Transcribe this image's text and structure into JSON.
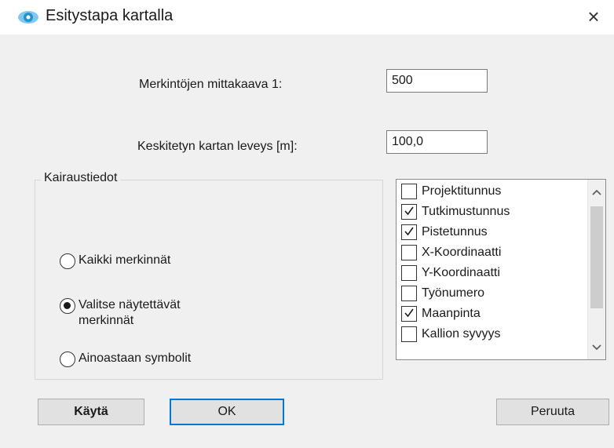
{
  "window": {
    "title": "Esitystapa kartalla",
    "close_glyph": "×",
    "icon": "map-eye-icon"
  },
  "fields": {
    "scale_label": "Merkintöjen mittakaava 1:",
    "scale_value": "500",
    "width_label": "Keskitetyn kartan leveys [m]:",
    "width_value": "100,0"
  },
  "group": {
    "title": "Kairaustiedot",
    "options": [
      {
        "label": "Kaikki merkinnät",
        "selected": false
      },
      {
        "label": "Valitse näytettävät merkinnät",
        "selected": true
      },
      {
        "label": "Ainoastaan symbolit",
        "selected": false
      }
    ]
  },
  "list": {
    "items": [
      {
        "label": "Projektitunnus",
        "checked": false
      },
      {
        "label": "Tutkimustunnus",
        "checked": true
      },
      {
        "label": "Pistetunnus",
        "checked": true
      },
      {
        "label": "X-Koordinaatti",
        "checked": false
      },
      {
        "label": "Y-Koordinaatti",
        "checked": false
      },
      {
        "label": "Työnumero",
        "checked": false
      },
      {
        "label": "Maanpinta",
        "checked": true
      },
      {
        "label": "Kallion syvyys",
        "checked": false
      }
    ],
    "scroll_up": "^",
    "scroll_down": "v"
  },
  "buttons": {
    "apply": "Käytä",
    "ok": "OK",
    "cancel": "Peruuta"
  },
  "colors": {
    "accent": "#0078d7",
    "dialog_bg": "#f0f0f0"
  }
}
